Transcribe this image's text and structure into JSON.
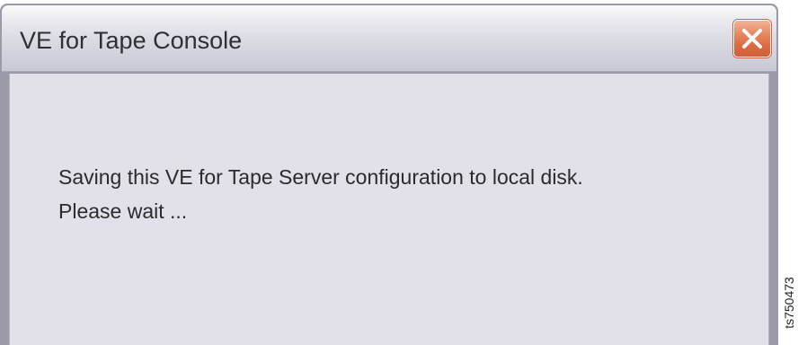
{
  "window": {
    "title": "VE for Tape Console",
    "close_icon": "close-icon"
  },
  "message": {
    "line1": "Saving this VE for Tape Server configuration to local disk.",
    "line2": "Please wait ..."
  },
  "figure_id": "ts750473",
  "colors": {
    "titlebar": "#dcdce4",
    "content_background": "#e2e1ea",
    "close_button": "#db6a3e",
    "frame": "#9a9aa8"
  }
}
